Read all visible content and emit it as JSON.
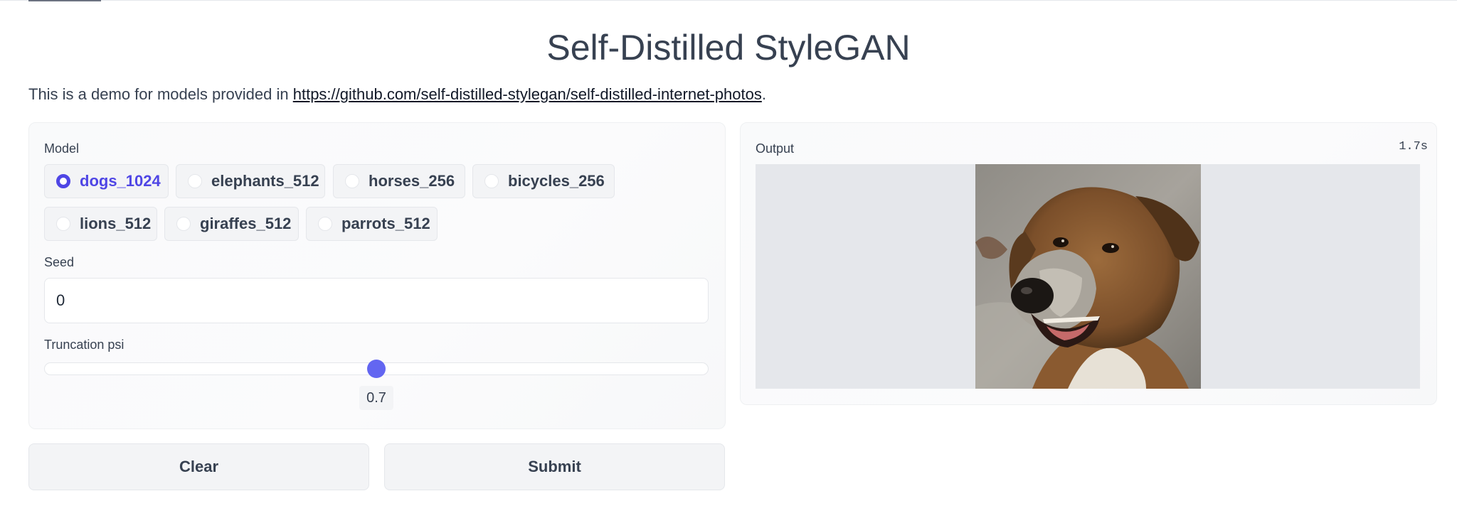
{
  "page": {
    "title": "Self-Distilled StyleGAN",
    "description_prefix": "This is a demo for models provided in ",
    "description_link": "https://github.com/self-distilled-stylegan/self-distilled-internet-photos",
    "description_suffix": "."
  },
  "inputs": {
    "model_label": "Model",
    "models": [
      {
        "label": "dogs_1024",
        "selected": true
      },
      {
        "label": "elephants_512",
        "selected": false
      },
      {
        "label": "horses_256",
        "selected": false
      },
      {
        "label": "bicycles_256",
        "selected": false
      },
      {
        "label": "lions_512",
        "selected": false
      },
      {
        "label": "giraffes_512",
        "selected": false
      },
      {
        "label": "parrots_512",
        "selected": false
      }
    ],
    "seed_label": "Seed",
    "seed_value": "0",
    "truncation_label": "Truncation psi",
    "truncation_value": "0.7",
    "truncation_fraction": 0.5
  },
  "buttons": {
    "clear_label": "Clear",
    "submit_label": "Submit"
  },
  "output": {
    "label": "Output",
    "timer": "1.7s",
    "image_subject": "dog-photo"
  },
  "colors": {
    "accent": "#4f46e5",
    "slider": "#6366f1"
  }
}
